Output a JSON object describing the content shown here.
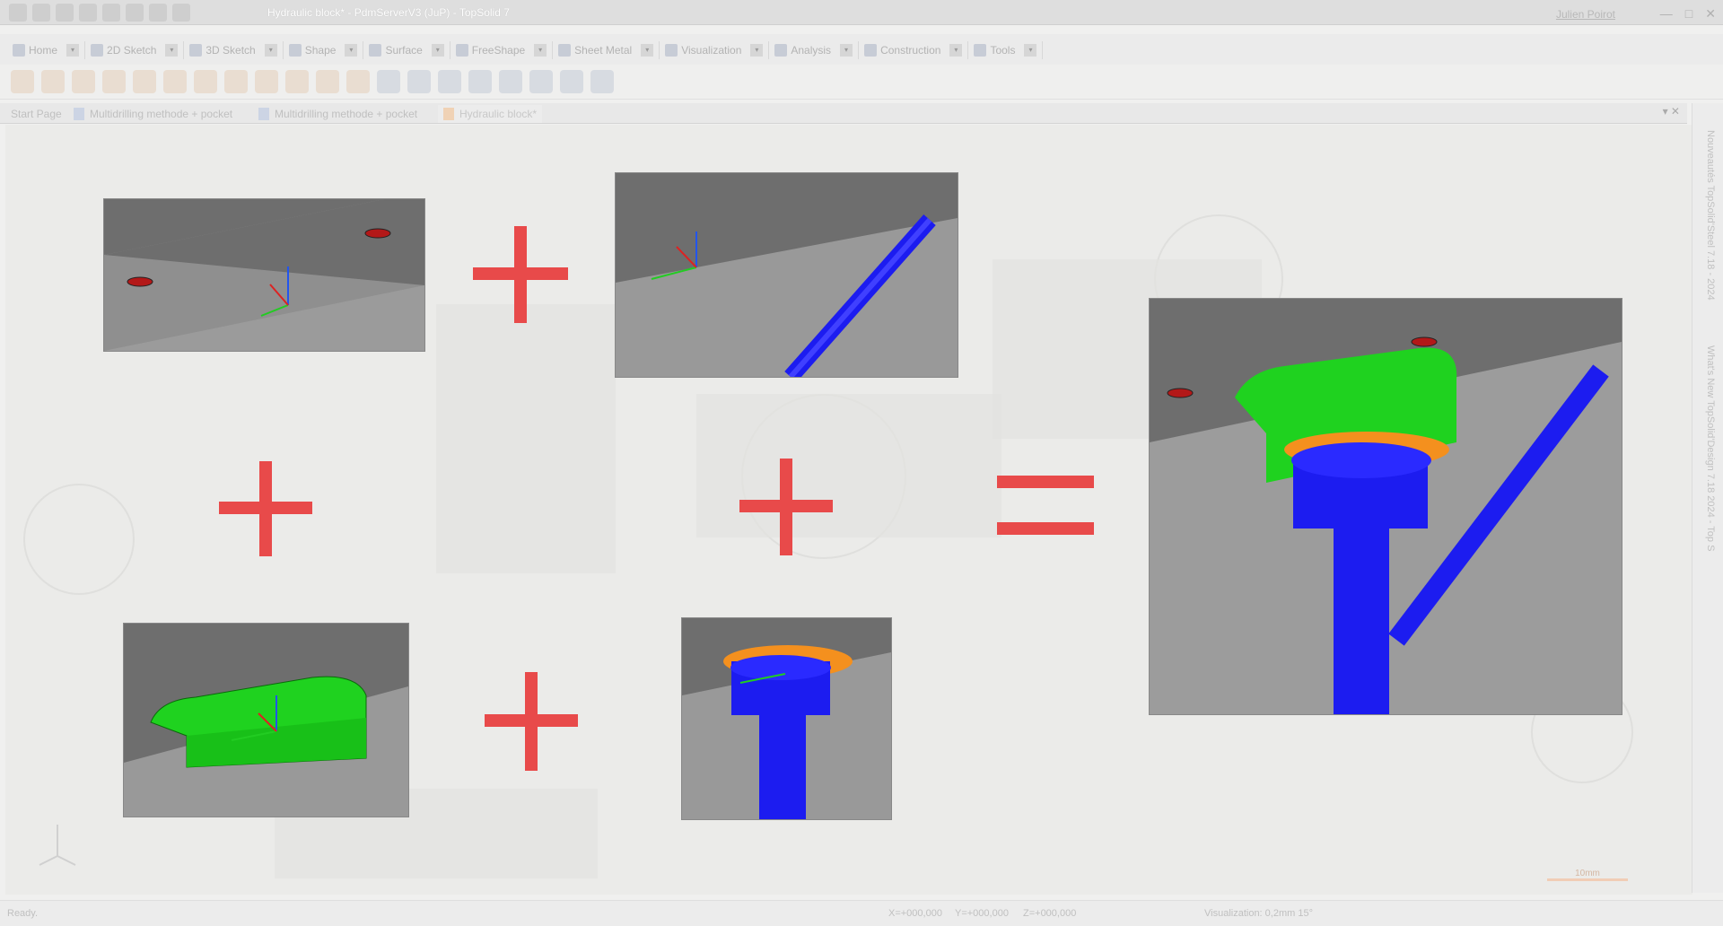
{
  "window": {
    "title": "Hydraulic block* - PdmServerV3 (JuP) - TopSolid 7",
    "user": "Julien Poirot"
  },
  "ribbon_tabs": [
    {
      "label": "Home",
      "icon": "home-icon"
    },
    {
      "label": "2D Sketch",
      "icon": "sketch2d-icon"
    },
    {
      "label": "3D Sketch",
      "icon": "sketch3d-icon"
    },
    {
      "label": "Shape",
      "icon": "shape-icon"
    },
    {
      "label": "Surface",
      "icon": "surface-icon"
    },
    {
      "label": "FreeShape",
      "icon": "freeshape-icon"
    },
    {
      "label": "Sheet Metal",
      "icon": "sheetmetal-icon"
    },
    {
      "label": "Visualization",
      "icon": "visualization-icon"
    },
    {
      "label": "Analysis",
      "icon": "analysis-icon"
    },
    {
      "label": "Construction",
      "icon": "construction-icon"
    },
    {
      "label": "Tools",
      "icon": "tools-icon"
    }
  ],
  "doc_tabs": [
    {
      "label": "Start Page"
    },
    {
      "label": "Multidrilling methode + pocket"
    },
    {
      "label": "Multidrilling methode + pocket"
    },
    {
      "label": "Hydraulic block*"
    }
  ],
  "side_panel": {
    "text1": "Nouveautés TopSolid'Steel 7.18 - 2024",
    "text2": "What's New TopSolid'Design 7.18 2024 - Top S"
  },
  "status": {
    "ready": "Ready.",
    "x": "X=+000,000",
    "y": "Y=+000,000",
    "z": "Z=+000,000",
    "visualization": "Visualization: 0,2mm 15°",
    "scale": "10mm"
  },
  "colors": {
    "plus": "#e84a4a",
    "block_top": "#6e6e6e",
    "block_front": "#9b9b9b",
    "drill_blue": "#1c1cf0",
    "pocket_green": "#1fd21f",
    "counterbore_orange": "#f4901e"
  }
}
